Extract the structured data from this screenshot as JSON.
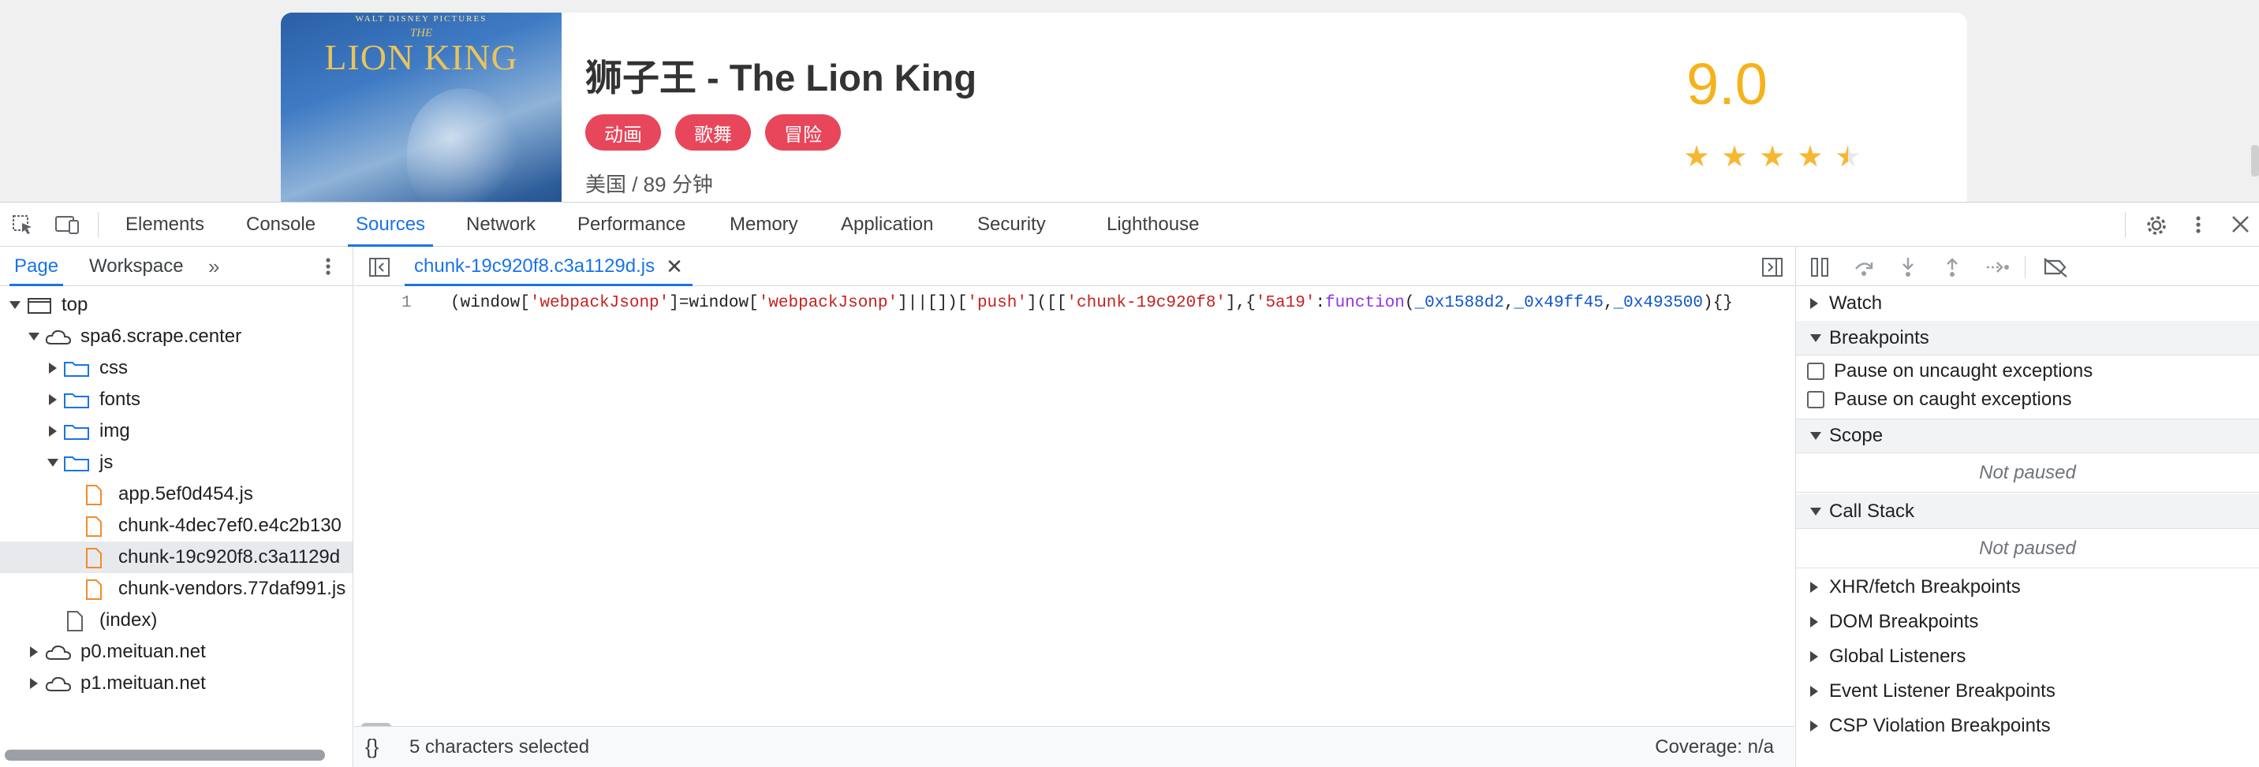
{
  "page": {
    "movie": {
      "title": "狮子王 - The Lion King",
      "tags": [
        "动画",
        "歌舞",
        "冒险"
      ],
      "meta": "美国 / 89 分钟",
      "score": "9.0",
      "rating_stars": 4.5,
      "poster": {
        "studio": "WALT DISNEY PICTURES",
        "the": "THE",
        "logo": "LION KING"
      }
    }
  },
  "devtools": {
    "tabs": [
      "Elements",
      "Console",
      "Sources",
      "Network",
      "Performance",
      "Memory",
      "Application",
      "Security",
      "Lighthouse"
    ],
    "active_tab": "Sources",
    "navigator": {
      "tabs": [
        "Page",
        "Workspace"
      ],
      "tree": [
        {
          "label": "top"
        },
        {
          "label": "spa6.scrape.center"
        },
        {
          "label": "css"
        },
        {
          "label": "fonts"
        },
        {
          "label": "img"
        },
        {
          "label": "js"
        },
        {
          "label": "app.5ef0d454.js"
        },
        {
          "label": "chunk-4dec7ef0.e4c2b130"
        },
        {
          "label": "chunk-19c920f8.c3a1129d"
        },
        {
          "label": "chunk-vendors.77daf991.js"
        },
        {
          "label": "(index)"
        },
        {
          "label": "p0.meituan.net"
        },
        {
          "label": "p1.meituan.net"
        }
      ]
    },
    "editor": {
      "file_tab": "chunk-19c920f8.c3a1129d.js",
      "line_number": "1",
      "code_tokens": [
        {
          "t": "(window[",
          "c": ""
        },
        {
          "t": "'webpackJsonp'",
          "c": "c-str"
        },
        {
          "t": "]=window[",
          "c": ""
        },
        {
          "t": "'webpackJsonp'",
          "c": "c-str"
        },
        {
          "t": "]||[])[",
          "c": ""
        },
        {
          "t": "'push'",
          "c": "c-str"
        },
        {
          "t": "]([[",
          "c": ""
        },
        {
          "t": "'chunk-19c920f8'",
          "c": "c-str"
        },
        {
          "t": "],{",
          "c": ""
        },
        {
          "t": "'5a19'",
          "c": "c-str"
        },
        {
          "t": ":",
          "c": ""
        },
        {
          "t": "function",
          "c": "c-kw"
        },
        {
          "t": "(",
          "c": ""
        },
        {
          "t": "_0x1588d2",
          "c": "c-var"
        },
        {
          "t": ",",
          "c": ""
        },
        {
          "t": "_0x49ff45",
          "c": "c-var"
        },
        {
          "t": ",",
          "c": ""
        },
        {
          "t": "_0x493500",
          "c": "c-var"
        },
        {
          "t": "){}",
          "c": ""
        }
      ],
      "status_left": "5 characters selected",
      "status_right": "Coverage: n/a"
    },
    "debugger": {
      "sections": {
        "watch": "Watch",
        "breakpoints": "Breakpoints",
        "pause_uncaught": "Pause on uncaught exceptions",
        "pause_caught": "Pause on caught exceptions",
        "scope": "Scope",
        "scope_status": "Not paused",
        "call_stack": "Call Stack",
        "call_stack_status": "Not paused",
        "xhr": "XHR/fetch Breakpoints",
        "dom": "DOM Breakpoints",
        "global": "Global Listeners",
        "event": "Event Listener Breakpoints",
        "csp": "CSP Violation Breakpoints"
      }
    }
  },
  "colors": {
    "accent": "#1a73e8",
    "tag": "#e8465a",
    "score": "#f6b21b"
  }
}
